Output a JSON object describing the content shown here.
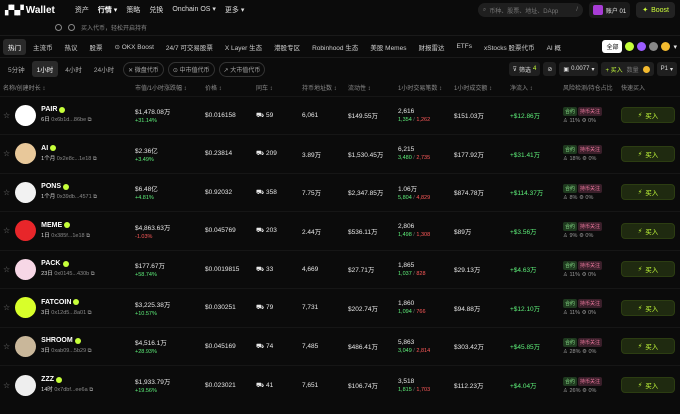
{
  "header": {
    "brand": "Wallet",
    "nav": [
      "资产",
      "行情 ▾",
      "策略",
      "兑换",
      "Onchain OS ▾",
      "更多 ▾"
    ],
    "search_placeholder": "币种、股票、地址、DApp",
    "search_key": "/",
    "account": "账户 01",
    "boost": "Boost"
  },
  "subbar": {
    "label": "买入代币，轻松开启持有"
  },
  "categories": [
    "热门",
    "主流币",
    "热议",
    "股票",
    "⊙ OKX Boost",
    "24/7 可交易股票",
    "X Layer 生态",
    "港股专区",
    "Robinhood 生态",
    "美股 Memes",
    "财报雷达",
    "ETFs",
    "xStocks 股票代币",
    "AI 概"
  ],
  "cat_right": {
    "all": "全部"
  },
  "timeframes": [
    "5分钟",
    "1小时",
    "4小时",
    "24小时"
  ],
  "caps": [
    "✕ 微盘代币",
    "⊙ 中市值代币",
    "↗ 大市值代币"
  ],
  "filter": {
    "label": "筛选",
    "count": "4",
    "slippage": "0.0077",
    "buy": "+ 买入",
    "amount_label": "数量",
    "profile": "P1"
  },
  "columns": [
    "名称/创建时长 ↕",
    "市值/1小时涨跌幅 ↕",
    "价格 ↕",
    "同车 ↕",
    "持币地址数 ↕",
    "流动性 ↕",
    "1小时交易笔数 ↕",
    "1小时成交额 ↕",
    "净流入 ↕",
    "风险检测/持仓占比",
    "快速买入"
  ],
  "rows": [
    {
      "sym": "PAIR",
      "age": "6日",
      "addr": "0x6b1d...86be",
      "mcap": "$1,478.08万",
      "chg": "+31.14%",
      "price": "$0.016158",
      "car": "59",
      "holders": "6,061",
      "liq": "$149.55万",
      "tx": "2,616",
      "buys": "1,354",
      "sells": "1,262",
      "vol": "$151.03万",
      "inflow": "+$12.86万",
      "t1": "合约",
      "t2": "持币关注",
      "p1": "11%",
      "p2": "0%",
      "color": "#ffffff",
      "dn": false
    },
    {
      "sym": "AI",
      "age": "1个月",
      "addr": "0x2e8c...1e18",
      "mcap": "$2.36亿",
      "chg": "+3.49%",
      "price": "$0.23814",
      "car": "209",
      "holders": "3.89万",
      "liq": "$1,530.45万",
      "tx": "6,215",
      "buys": "3,480",
      "sells": "2,735",
      "vol": "$177.92万",
      "inflow": "+$31.41万",
      "t1": "合约",
      "t2": "持币关注",
      "p1": "18%",
      "p2": "0%",
      "color": "#e8c89a",
      "dn": false
    },
    {
      "sym": "PONS",
      "age": "1个月",
      "addr": "0x39db...4571",
      "mcap": "$6.48亿",
      "chg": "+4.81%",
      "price": "$0.92032",
      "car": "358",
      "holders": "7.75万",
      "liq": "$2,347.85万",
      "tx": "1.06万",
      "buys": "5,804",
      "sells": "4,829",
      "vol": "$874.78万",
      "inflow": "+$114.37万",
      "t1": "合约",
      "t2": "持币关注",
      "p1": "8%",
      "p2": "0%",
      "color": "#f2f2f2",
      "dn": false
    },
    {
      "sym": "MEME",
      "age": "1日",
      "addr": "0x385f...1e18",
      "mcap": "$4,863.63万",
      "chg": "-1.03%",
      "price": "$0.045769",
      "car": "203",
      "holders": "2.44万",
      "liq": "$536.11万",
      "tx": "2,806",
      "buys": "1,498",
      "sells": "1,308",
      "vol": "$89万",
      "inflow": "+$3.56万",
      "t1": "合约",
      "t2": "持币关注",
      "p1": "9%",
      "p2": "0%",
      "color": "#e8262a",
      "dn": true
    },
    {
      "sym": "PACK",
      "age": "23日",
      "addr": "0x0145...430b",
      "mcap": "$177.67万",
      "chg": "+58.74%",
      "price": "$0.0019815",
      "car": "33",
      "holders": "4,669",
      "liq": "$27.71万",
      "tx": "1,865",
      "buys": "1,037",
      "sells": "828",
      "vol": "$29.13万",
      "inflow": "+$4.63万",
      "t1": "合约",
      "t2": "持币关注",
      "p1": "11%",
      "p2": "0%",
      "color": "#f7d7e6",
      "dn": false
    },
    {
      "sym": "FATCOIN",
      "age": "3日",
      "addr": "0x12d5...8a01",
      "mcap": "$3,225.38万",
      "chg": "+10.57%",
      "price": "$0.030251",
      "car": "79",
      "holders": "7,731",
      "liq": "$202.74万",
      "tx": "1,860",
      "buys": "1,094",
      "sells": "766",
      "vol": "$94.88万",
      "inflow": "+$12.10万",
      "t1": "合约",
      "t2": "持币关注",
      "p1": "11%",
      "p2": "0%",
      "color": "#d8ff2a",
      "dn": false
    },
    {
      "sym": "SHROOM",
      "age": "3日",
      "addr": "0xab09...5b29",
      "mcap": "$4,516.1万",
      "chg": "+28.93%",
      "price": "$0.045169",
      "car": "74",
      "holders": "7,485",
      "liq": "$486.41万",
      "tx": "5,863",
      "buys": "3,049",
      "sells": "2,814",
      "vol": "$303.42万",
      "inflow": "+$45.85万",
      "t1": "合约",
      "t2": "持币关注",
      "p1": "28%",
      "p2": "0%",
      "color": "#c9b79a",
      "dn": false
    },
    {
      "sym": "ZZZ",
      "age": "14时",
      "addr": "0x7dbf...ee6a",
      "mcap": "$1,933.79万",
      "chg": "+19.56%",
      "price": "$0.023021",
      "car": "41",
      "holders": "7,651",
      "liq": "$106.74万",
      "tx": "3,518",
      "buys": "1,815",
      "sells": "1,703",
      "vol": "$112.23万",
      "inflow": "+$4.04万",
      "t1": "合约",
      "t2": "持币关注",
      "p1": "26%",
      "p2": "0%",
      "color": "#eeeeee",
      "dn": false
    }
  ],
  "buy_label": "买入"
}
